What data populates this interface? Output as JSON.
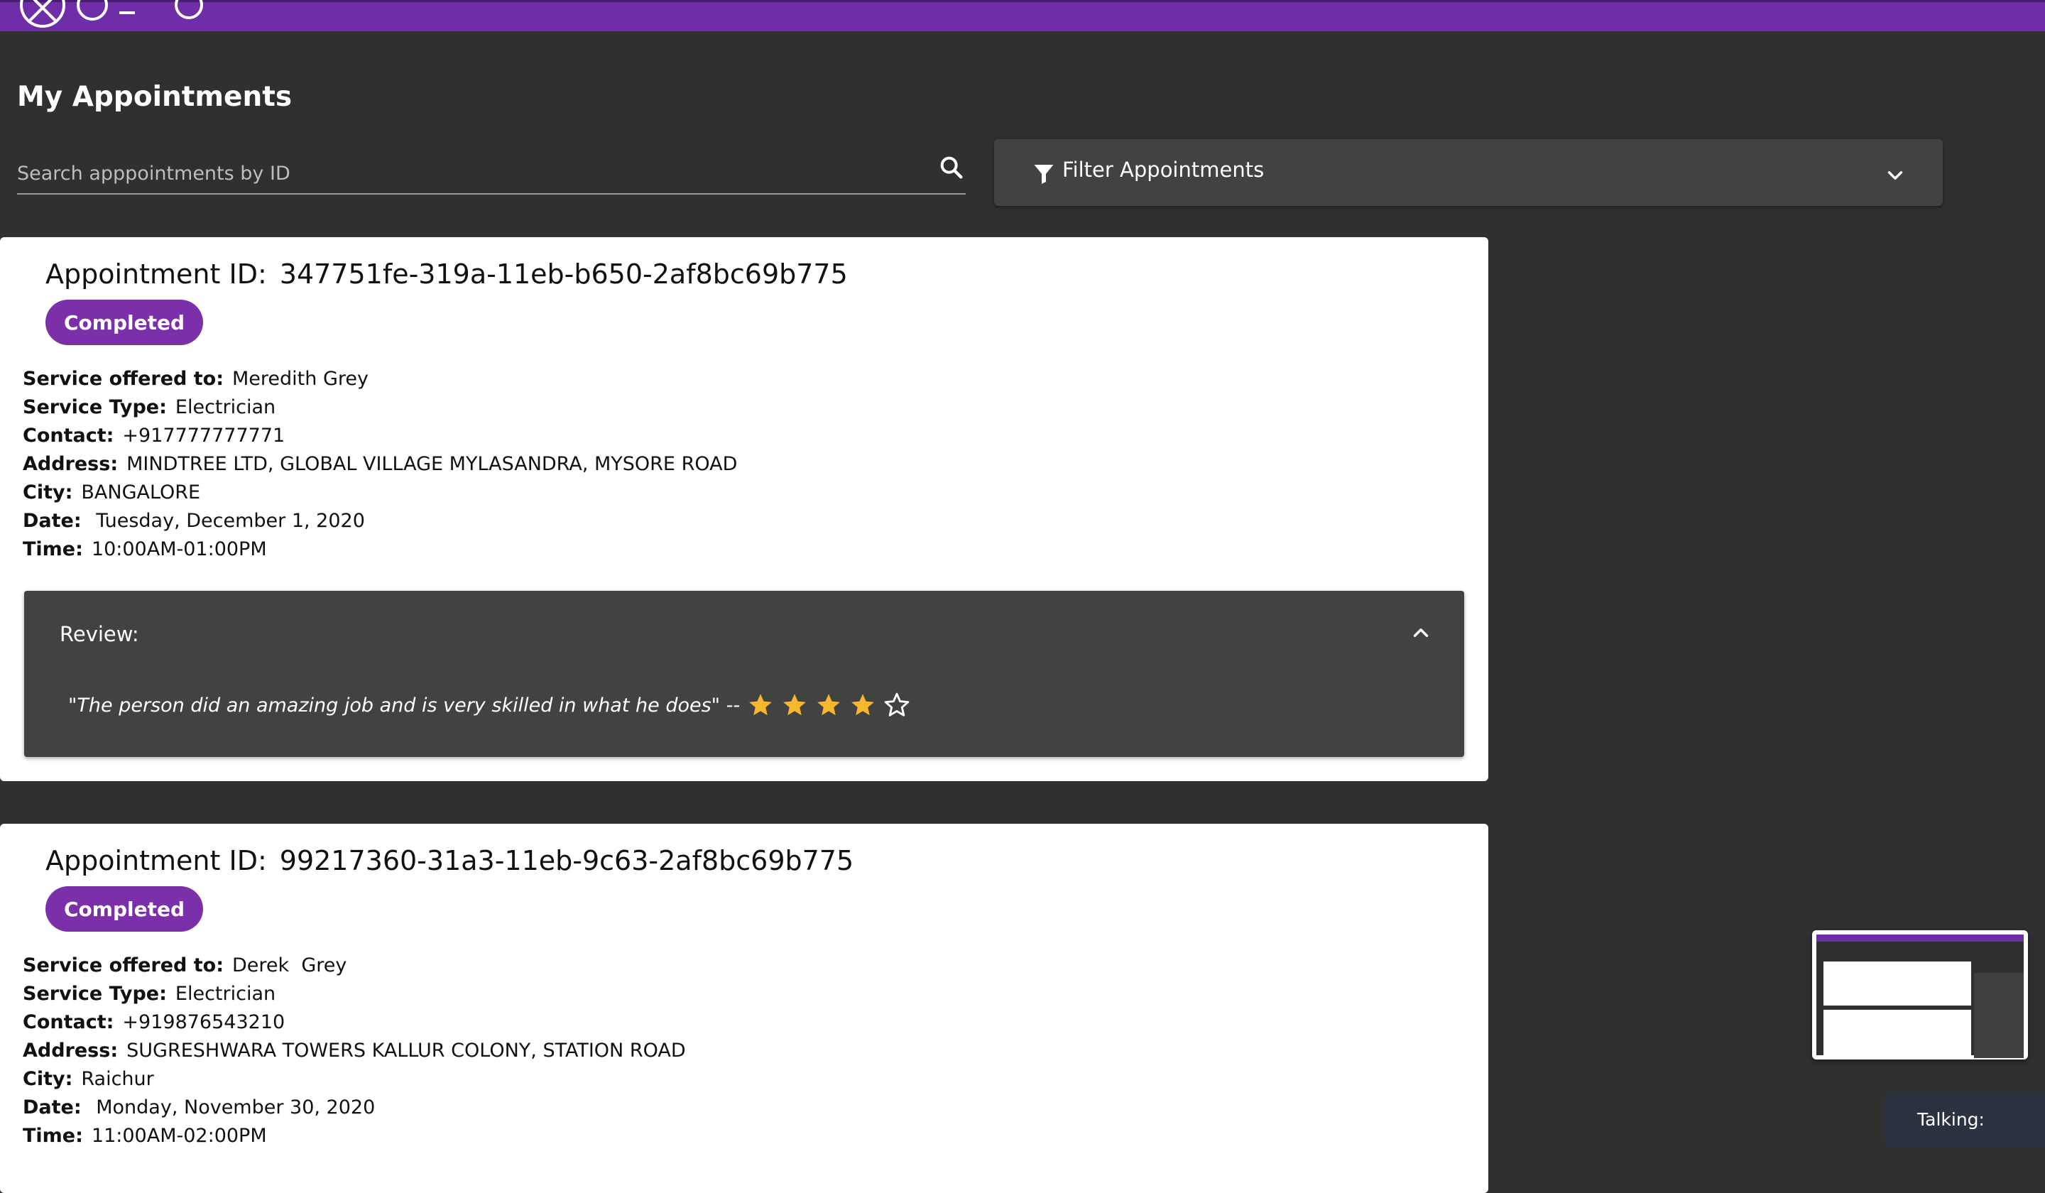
{
  "page": {
    "title": "My Appointments",
    "brand_color": "#6f2da8",
    "background_color": "#303030"
  },
  "search": {
    "placeholder": "Search apppointments by ID",
    "value": ""
  },
  "filter": {
    "label": "Filter Appointments",
    "expanded": false
  },
  "appointments": [
    {
      "id_label": "Appointment ID:",
      "id": "347751fe-319a-11eb-b650-2af8bc69b775",
      "status": "Completed",
      "fields": {
        "service_offered_to": {
          "label": "Service offered to:",
          "value": "Meredith  Grey"
        },
        "service_type": {
          "label": "Service Type:",
          "value": "Electrician"
        },
        "contact": {
          "label": "Contact:",
          "value": "+917777777771"
        },
        "address": {
          "label": "Address:",
          "value": "MINDTREE LTD, GLOBAL VILLAGE MYLASANDRA, MYSORE ROAD"
        },
        "city": {
          "label": "City:",
          "value": "BANGALORE"
        },
        "date": {
          "label": "Date:",
          "value": " Tuesday, December 1, 2020"
        },
        "time": {
          "label": "Time:",
          "value": "10:00AM-01:00PM"
        }
      },
      "review": {
        "title": "Review:",
        "text": "\"The person did an amazing job and is very skilled in what he does\" --",
        "rating": 4,
        "max_rating": 5,
        "expanded": true
      }
    },
    {
      "id_label": "Appointment ID:",
      "id": "99217360-31a3-11eb-9c63-2af8bc69b775",
      "status": "Completed",
      "fields": {
        "service_offered_to": {
          "label": "Service offered to:",
          "value": "Derek  Grey"
        },
        "service_type": {
          "label": "Service Type:",
          "value": "Electrician"
        },
        "contact": {
          "label": "Contact:",
          "value": "+919876543210"
        },
        "address": {
          "label": "Address:",
          "value": "SUGRESHWARA TOWERS KALLUR COLONY, STATION ROAD"
        },
        "city": {
          "label": "City:",
          "value": "Raichur"
        },
        "date": {
          "label": "Date:",
          "value": " Monday, November 30, 2020"
        },
        "time": {
          "label": "Time:",
          "value": "11:00AM-02:00PM"
        }
      }
    }
  ],
  "overlay": {
    "talking_label": "Talking:"
  },
  "icons": {
    "search": "search-icon",
    "filter": "filter-icon",
    "chevron_down": "chevron-down-icon",
    "chevron_up": "chevron-up-icon",
    "star_filled": "star-icon",
    "star_empty": "star-outline-icon"
  },
  "colors": {
    "badge": "#7b2fa8",
    "star": "#f5b82e",
    "panel": "#424242"
  }
}
